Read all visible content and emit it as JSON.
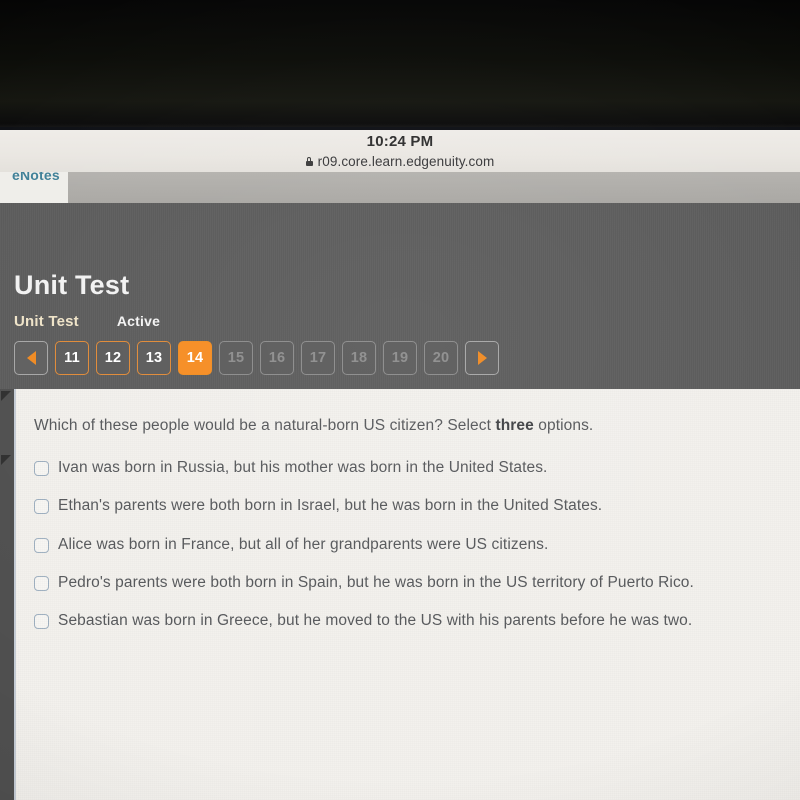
{
  "device": {
    "status_time": "10:24 PM",
    "url": "r09.core.learn.edgenuity.com",
    "lock_icon": "lock-icon"
  },
  "browser_tabs": [
    {
      "label": "eNotes",
      "active": true
    }
  ],
  "header": {
    "title": "Unit Test",
    "subtitle": "Unit Test",
    "status": "Active",
    "accent_color": "#f68c22",
    "background_color": "#5b5b5b"
  },
  "pager": {
    "prev_icon": "triangle-left-icon",
    "next_icon": "triangle-right-icon",
    "current": "14",
    "items": [
      {
        "label": "11",
        "state": "done"
      },
      {
        "label": "12",
        "state": "done"
      },
      {
        "label": "13",
        "state": "done"
      },
      {
        "label": "14",
        "state": "current"
      },
      {
        "label": "15",
        "state": "future"
      },
      {
        "label": "16",
        "state": "future"
      },
      {
        "label": "17",
        "state": "future"
      },
      {
        "label": "18",
        "state": "future"
      },
      {
        "label": "19",
        "state": "future"
      },
      {
        "label": "20",
        "state": "future"
      }
    ]
  },
  "question": {
    "prompt_part1": "Which of these people would be a natural-born US citizen? Select ",
    "prompt_emphasis": "three",
    "prompt_part2": " options.",
    "select_count": 3,
    "options": [
      {
        "label": "Ivan was born in Russia, but his mother was born in the United States.",
        "checked": false
      },
      {
        "label": "Ethan's parents were both born in Israel, but he was born in the United States.",
        "checked": false
      },
      {
        "label": "Alice was born in France, but all of her grandparents were US citizens.",
        "checked": false
      },
      {
        "label": "Pedro's parents were both born in Spain, but he was born in the US territory of Puerto Rico.",
        "checked": false
      },
      {
        "label": "Sebastian was born in Greece, but he moved to the US with his parents before he was two.",
        "checked": false
      }
    ]
  }
}
